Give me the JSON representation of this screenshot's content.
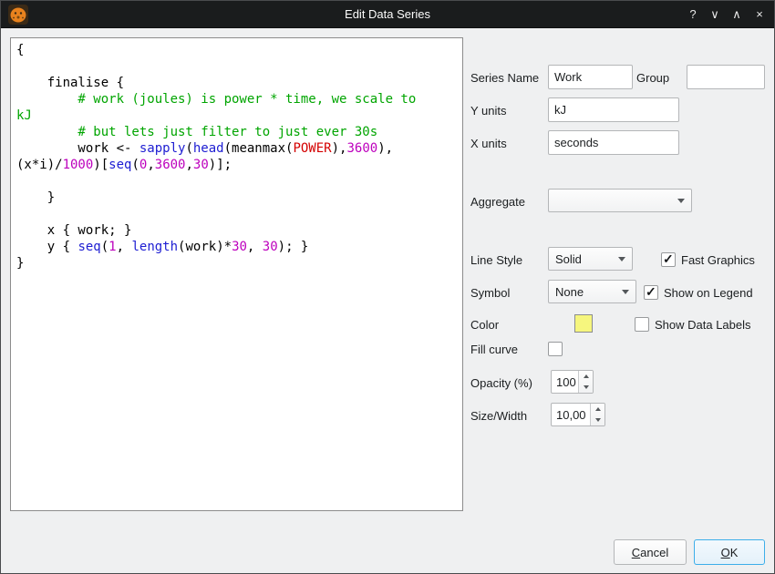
{
  "titlebar": {
    "title": "Edit Data Series",
    "help_glyph": "?",
    "keep_below_glyph": "∨",
    "keep_above_glyph": "∧",
    "close_glyph": "×"
  },
  "editor": {
    "syntax_colors": {
      "default": "#000000",
      "comment": "#00a500",
      "function": "#1d1dd2",
      "datafield": "#d40000",
      "number": "#bd00bd"
    },
    "lines": [
      [
        [
          "k",
          "{"
        ]
      ],
      [],
      [
        [
          "k",
          "    finalise {"
        ]
      ],
      [
        [
          "c",
          "        # work (joules) is power * time, we scale to"
        ]
      ],
      [
        [
          "c",
          "kJ"
        ]
      ],
      [
        [
          "c",
          "        # but lets just filter to just ever 30s"
        ]
      ],
      [
        [
          "k",
          "        work <- "
        ],
        [
          "f",
          "sapply"
        ],
        [
          "k",
          "("
        ],
        [
          "f",
          "head"
        ],
        [
          "k",
          "(meanmax("
        ],
        [
          "r",
          "POWER"
        ],
        [
          "k",
          "),"
        ],
        [
          "n",
          "3600"
        ],
        [
          "k",
          "),"
        ]
      ],
      [
        [
          "k",
          "(x*i)/"
        ],
        [
          "n",
          "1000"
        ],
        [
          "k",
          ")["
        ],
        [
          "f",
          "seq"
        ],
        [
          "k",
          "("
        ],
        [
          "n",
          "0"
        ],
        [
          "k",
          ","
        ],
        [
          "n",
          "3600"
        ],
        [
          "k",
          ","
        ],
        [
          "n",
          "30"
        ],
        [
          "k",
          ")];"
        ]
      ],
      [],
      [
        [
          "k",
          "    }"
        ]
      ],
      [],
      [
        [
          "k",
          "    x { work; }"
        ]
      ],
      [
        [
          "k",
          "    y { "
        ],
        [
          "f",
          "seq"
        ],
        [
          "k",
          "("
        ],
        [
          "n",
          "1"
        ],
        [
          "k",
          ", "
        ],
        [
          "f",
          "length"
        ],
        [
          "k",
          "(work)*"
        ],
        [
          "n",
          "30"
        ],
        [
          "k",
          ", "
        ],
        [
          "n",
          "30"
        ],
        [
          "k",
          "); }"
        ]
      ],
      [
        [
          "k",
          "}"
        ]
      ]
    ]
  },
  "form": {
    "series_name": {
      "label": "Series Name",
      "value": "Work"
    },
    "group": {
      "label": "Group",
      "value": ""
    },
    "y_units": {
      "label": "Y units",
      "value": "kJ"
    },
    "x_units": {
      "label": "X units",
      "value": "seconds"
    },
    "aggregate": {
      "label": "Aggregate",
      "value": ""
    },
    "line_style": {
      "label": "Line Style",
      "value": "Solid"
    },
    "fast_graphics": {
      "label": "Fast Graphics",
      "checked": true
    },
    "symbol": {
      "label": "Symbol",
      "value": "None"
    },
    "show_on_legend": {
      "label": "Show on Legend",
      "checked": true
    },
    "color": {
      "label": "Color",
      "swatch": "#f6f67e"
    },
    "show_data_labels": {
      "label": "Show Data Labels",
      "checked": false
    },
    "fill_curve": {
      "label": "Fill curve",
      "checked": false
    },
    "opacity": {
      "label": "Opacity (%)",
      "value": "100"
    },
    "size_width": {
      "label": "Size/Width",
      "value": "10,00"
    }
  },
  "buttons": {
    "cancel": "Cancel",
    "ok": "OK"
  }
}
